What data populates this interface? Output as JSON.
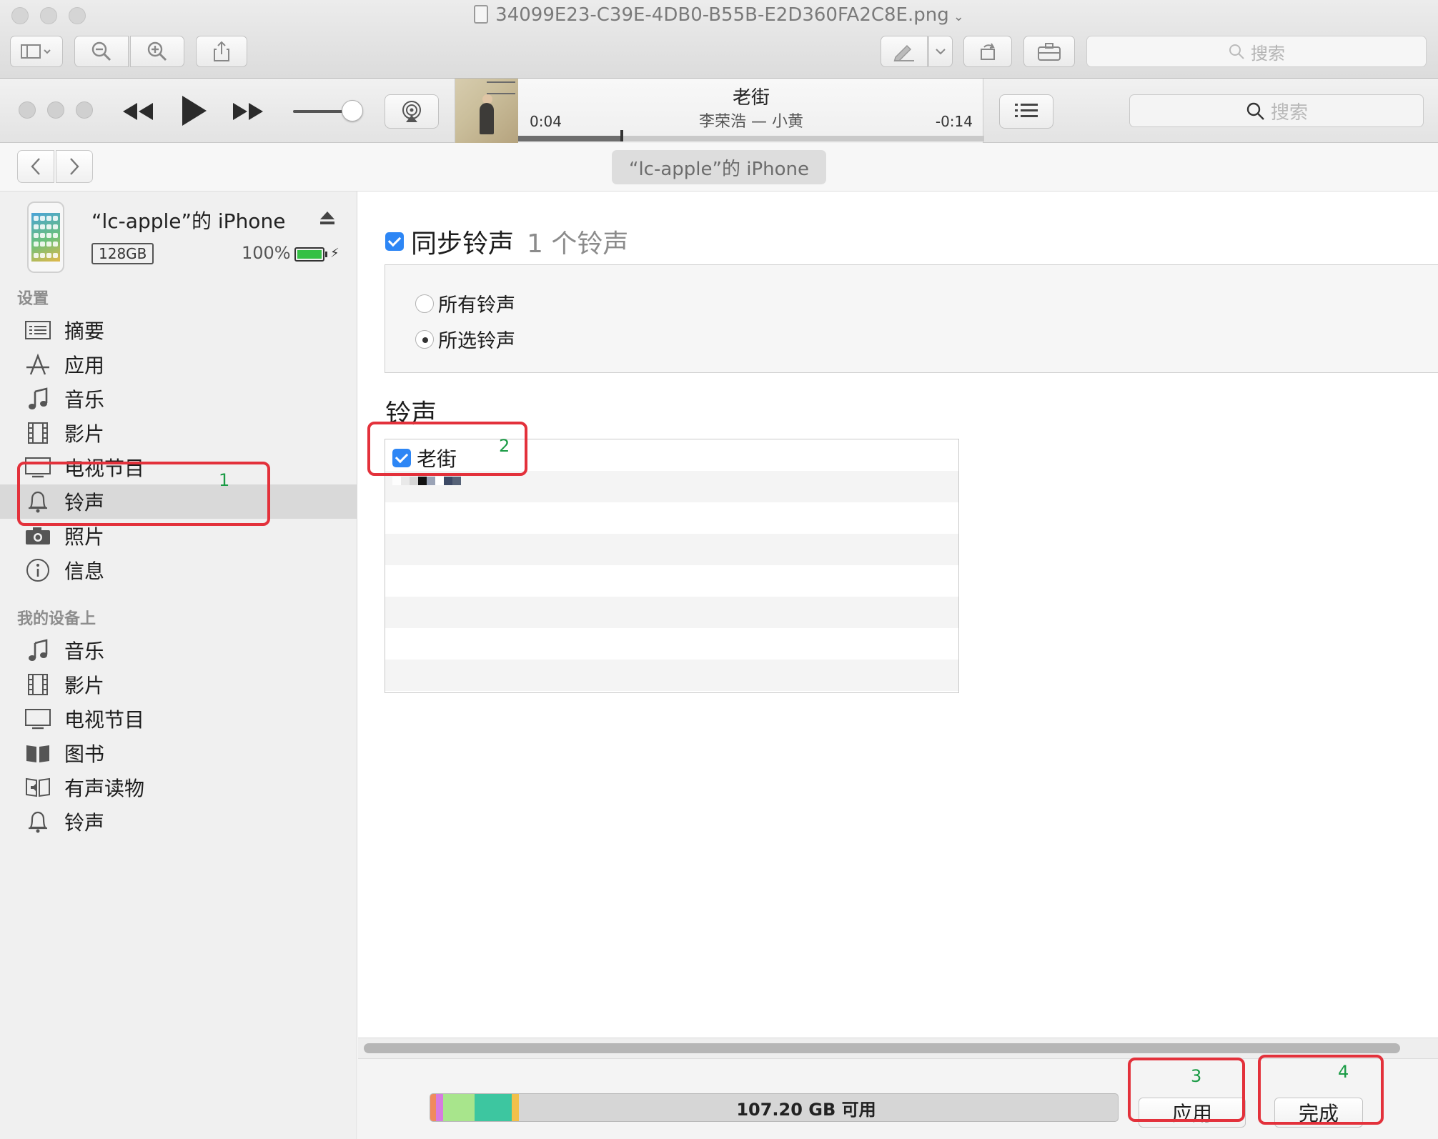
{
  "window": {
    "title": "34099E23-C39E-4DB0-B55B-E2D360FA2C8E.png",
    "search_placeholder": "搜索"
  },
  "player": {
    "song_title": "老街",
    "song_artist": "李荣浩 — 小黄",
    "time_elapsed": "0:04",
    "time_remaining": "-0:14",
    "progress_fraction": 0.22,
    "volume_fraction": 0.85,
    "search_placeholder": "搜索"
  },
  "nav": {
    "device_pill": "“lc-apple”的 iPhone"
  },
  "device": {
    "name": "“lc-apple”的 iPhone",
    "capacity": "128GB",
    "battery": "100%"
  },
  "sidebar": {
    "settings_title": "设置",
    "settings_items": [
      {
        "label": "摘要",
        "icon": "summary-icon"
      },
      {
        "label": "应用",
        "icon": "apps-icon"
      },
      {
        "label": "音乐",
        "icon": "music-note-icon"
      },
      {
        "label": "影片",
        "icon": "film-icon"
      },
      {
        "label": "电视节目",
        "icon": "tv-icon"
      },
      {
        "label": "铃声",
        "icon": "bell-icon",
        "selected": true
      },
      {
        "label": "照片",
        "icon": "camera-icon"
      },
      {
        "label": "信息",
        "icon": "info-icon"
      }
    ],
    "ondevice_title": "我的设备上",
    "ondevice_items": [
      {
        "label": "音乐",
        "icon": "music-note-icon"
      },
      {
        "label": "影片",
        "icon": "film-icon"
      },
      {
        "label": "电视节目",
        "icon": "tv-icon"
      },
      {
        "label": "图书",
        "icon": "book-icon"
      },
      {
        "label": "有声读物",
        "icon": "audiobook-icon"
      },
      {
        "label": "铃声",
        "icon": "bell-icon"
      }
    ]
  },
  "main": {
    "sync_label": "同步铃声",
    "sync_checked": true,
    "sync_count": "1 个铃声",
    "options": [
      {
        "label": "所有铃声",
        "selected": false
      },
      {
        "label": "所选铃声",
        "selected": true
      }
    ],
    "list_heading": "铃声",
    "ringtones": [
      {
        "name": "老街",
        "checked": true
      }
    ]
  },
  "footer": {
    "capacity_label": "107.20 GB 可用",
    "apply_button": "应用",
    "done_button": "完成",
    "storage_colors": [
      "#f08a5d",
      "#d77ae0",
      "#a8e58c",
      "#3dc6a0",
      "#f2c04a"
    ]
  },
  "annotations": [
    "1",
    "2",
    "3",
    "4"
  ],
  "colors": {
    "accent_blue": "#2d86f5",
    "annotation_red": "#e3313b",
    "annotation_number_green": "#1a9b45"
  }
}
